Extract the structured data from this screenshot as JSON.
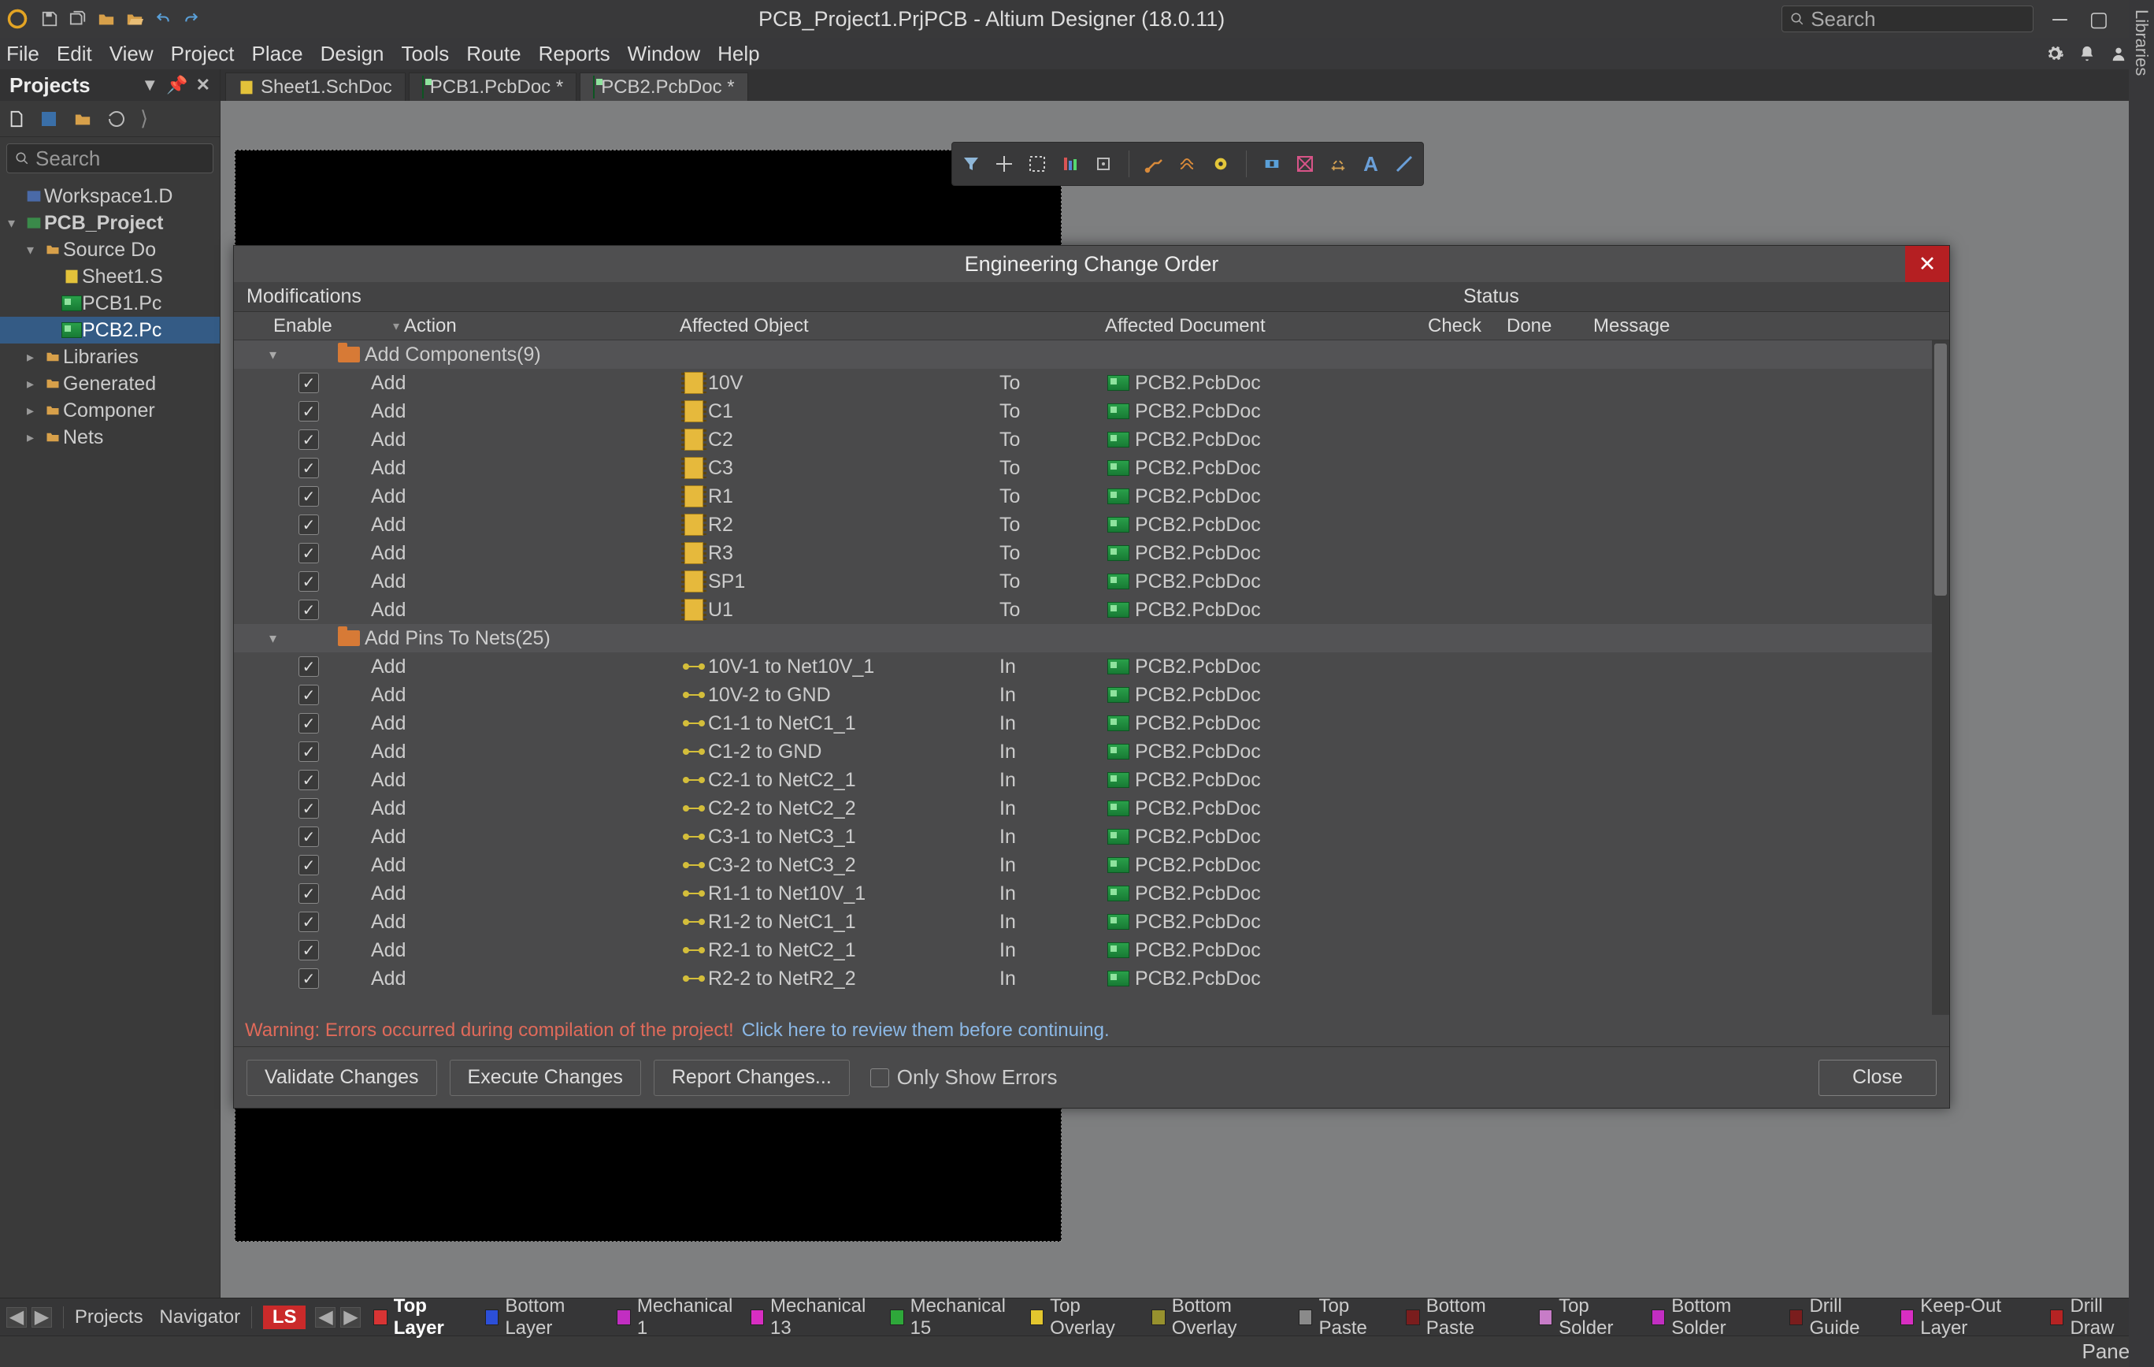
{
  "titlebar": {
    "title": "PCB_Project1.PrjPCB - Altium Designer (18.0.11)",
    "search_placeholder": "Search"
  },
  "menu": [
    "File",
    "Edit",
    "View",
    "Project",
    "Place",
    "Design",
    "Tools",
    "Route",
    "Reports",
    "Window",
    "Help"
  ],
  "projects_panel": {
    "title": "Projects",
    "search_placeholder": "Search",
    "tree": [
      {
        "lvl": 0,
        "exp": "",
        "icon": "ws",
        "label": "Workspace1.D",
        "sel": false
      },
      {
        "lvl": 0,
        "exp": "▾",
        "icon": "prj",
        "label": "PCB_Project",
        "sel": false,
        "bold": true
      },
      {
        "lvl": 1,
        "exp": "▾",
        "icon": "folder",
        "label": "Source Do",
        "sel": false
      },
      {
        "lvl": 2,
        "exp": "",
        "icon": "sch",
        "label": "Sheet1.S",
        "sel": false
      },
      {
        "lvl": 2,
        "exp": "",
        "icon": "pcb",
        "label": "PCB1.Pc",
        "sel": false
      },
      {
        "lvl": 2,
        "exp": "",
        "icon": "pcb",
        "label": "PCB2.Pc",
        "sel": true
      },
      {
        "lvl": 1,
        "exp": "▸",
        "icon": "folder",
        "label": "Libraries",
        "sel": false
      },
      {
        "lvl": 1,
        "exp": "▸",
        "icon": "folder",
        "label": "Generated",
        "sel": false
      },
      {
        "lvl": 1,
        "exp": "▸",
        "icon": "folder",
        "label": "Componer",
        "sel": false
      },
      {
        "lvl": 1,
        "exp": "▸",
        "icon": "folder",
        "label": "Nets",
        "sel": false
      }
    ]
  },
  "tabs": [
    {
      "label": "Sheet1.SchDoc",
      "icon": "sch",
      "active": false,
      "dirty": false
    },
    {
      "label": "PCB1.PcbDoc *",
      "icon": "pcb",
      "active": false,
      "dirty": true
    },
    {
      "label": "PCB2.PcbDoc *",
      "icon": "pcb",
      "active": true,
      "dirty": true
    }
  ],
  "right_panel_label": "Libraries",
  "dialog": {
    "title": "Engineering Change Order",
    "head1": {
      "mods": "Modifications",
      "status": "Status"
    },
    "head2": {
      "enable": "Enable",
      "action": "Action",
      "object": "Affected Object",
      "doc": "Affected Document",
      "check": "Check",
      "done": "Done",
      "msg": "Message"
    },
    "groups": [
      {
        "label": "Add Components(9)",
        "kind": "comp",
        "rows": [
          {
            "en": true,
            "act": "Add",
            "obj": "10V",
            "to": "To",
            "doc": "PCB2.PcbDoc"
          },
          {
            "en": true,
            "act": "Add",
            "obj": "C1",
            "to": "To",
            "doc": "PCB2.PcbDoc"
          },
          {
            "en": true,
            "act": "Add",
            "obj": "C2",
            "to": "To",
            "doc": "PCB2.PcbDoc"
          },
          {
            "en": true,
            "act": "Add",
            "obj": "C3",
            "to": "To",
            "doc": "PCB2.PcbDoc"
          },
          {
            "en": true,
            "act": "Add",
            "obj": "R1",
            "to": "To",
            "doc": "PCB2.PcbDoc"
          },
          {
            "en": true,
            "act": "Add",
            "obj": "R2",
            "to": "To",
            "doc": "PCB2.PcbDoc"
          },
          {
            "en": true,
            "act": "Add",
            "obj": "R3",
            "to": "To",
            "doc": "PCB2.PcbDoc"
          },
          {
            "en": true,
            "act": "Add",
            "obj": "SP1",
            "to": "To",
            "doc": "PCB2.PcbDoc"
          },
          {
            "en": true,
            "act": "Add",
            "obj": "U1",
            "to": "To",
            "doc": "PCB2.PcbDoc"
          }
        ]
      },
      {
        "label": "Add Pins To Nets(25)",
        "kind": "net",
        "rows": [
          {
            "en": true,
            "act": "Add",
            "obj": "10V-1 to Net10V_1",
            "to": "In",
            "doc": "PCB2.PcbDoc"
          },
          {
            "en": true,
            "act": "Add",
            "obj": "10V-2 to GND",
            "to": "In",
            "doc": "PCB2.PcbDoc"
          },
          {
            "en": true,
            "act": "Add",
            "obj": "C1-1 to NetC1_1",
            "to": "In",
            "doc": "PCB2.PcbDoc"
          },
          {
            "en": true,
            "act": "Add",
            "obj": "C1-2 to GND",
            "to": "In",
            "doc": "PCB2.PcbDoc"
          },
          {
            "en": true,
            "act": "Add",
            "obj": "C2-1 to NetC2_1",
            "to": "In",
            "doc": "PCB2.PcbDoc"
          },
          {
            "en": true,
            "act": "Add",
            "obj": "C2-2 to NetC2_2",
            "to": "In",
            "doc": "PCB2.PcbDoc"
          },
          {
            "en": true,
            "act": "Add",
            "obj": "C3-1 to NetC3_1",
            "to": "In",
            "doc": "PCB2.PcbDoc"
          },
          {
            "en": true,
            "act": "Add",
            "obj": "C3-2 to NetC3_2",
            "to": "In",
            "doc": "PCB2.PcbDoc"
          },
          {
            "en": true,
            "act": "Add",
            "obj": "R1-1 to Net10V_1",
            "to": "In",
            "doc": "PCB2.PcbDoc"
          },
          {
            "en": true,
            "act": "Add",
            "obj": "R1-2 to NetC1_1",
            "to": "In",
            "doc": "PCB2.PcbDoc"
          },
          {
            "en": true,
            "act": "Add",
            "obj": "R2-1 to NetC2_1",
            "to": "In",
            "doc": "PCB2.PcbDoc"
          },
          {
            "en": true,
            "act": "Add",
            "obj": "R2-2 to NetR2_2",
            "to": "In",
            "doc": "PCB2.PcbDoc"
          }
        ]
      }
    ],
    "warning1": "Warning: Errors occurred during compilation of the project!",
    "warning2": "Click here to review them before continuing.",
    "buttons": {
      "validate": "Validate Changes",
      "execute": "Execute Changes",
      "report": "Report Changes...",
      "only": "Only Show Errors",
      "close": "Close"
    }
  },
  "layerbar": {
    "tabs_left": [
      "Projects",
      "Navigator"
    ],
    "ls": "LS",
    "layers": [
      {
        "label": "Top Layer",
        "color": "#d83434",
        "active": true
      },
      {
        "label": "Bottom Layer",
        "color": "#2c4fd8",
        "active": false
      },
      {
        "label": "Mechanical 1",
        "color": "#c22ec2",
        "active": false
      },
      {
        "label": "Mechanical 13",
        "color": "#d82ec2",
        "active": false
      },
      {
        "label": "Mechanical 15",
        "color": "#2ea83a",
        "active": false
      },
      {
        "label": "Top Overlay",
        "color": "#e3c62e",
        "active": false
      },
      {
        "label": "Bottom Overlay",
        "color": "#97912e",
        "active": false
      },
      {
        "label": "Top Paste",
        "color": "#8a8a8a",
        "active": false
      },
      {
        "label": "Bottom Paste",
        "color": "#7a1d1d",
        "active": false
      },
      {
        "label": "Top Solder",
        "color": "#c77cc7",
        "active": false
      },
      {
        "label": "Bottom Solder",
        "color": "#c22ec2",
        "active": false
      },
      {
        "label": "Drill Guide",
        "color": "#7a1d1d",
        "active": false
      },
      {
        "label": "Keep-Out Layer",
        "color": "#d82ec2",
        "active": false
      },
      {
        "label": "Drill Draw",
        "color": "#b52323",
        "active": false
      }
    ]
  },
  "statusbar": {
    "panels": "Panels"
  }
}
